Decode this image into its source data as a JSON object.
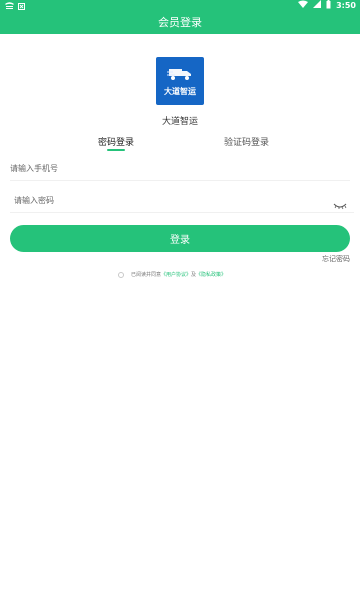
{
  "status_bar": {
    "time": "3:50",
    "left_icons": [
      "wifi-status-icon",
      "notification-icon"
    ],
    "right_icons": [
      "wifi-icon",
      "signal-icon",
      "battery-icon"
    ]
  },
  "header": {
    "title": "会员登录"
  },
  "logo": {
    "text": "大道智运"
  },
  "app": {
    "name": "大道智运"
  },
  "tabs": {
    "password_login": "密码登录",
    "code_login": "验证码登录"
  },
  "form": {
    "phone_placeholder": "请输入手机号",
    "password_placeholder": "请输入密码",
    "login_button": "登录",
    "forgot_password": "忘记密码"
  },
  "agreement": {
    "prefix": "已阅读并同意",
    "user_agreement": "《用户协议》",
    "conjunction": "及",
    "privacy_policy": "《隐私政策》"
  },
  "colors": {
    "primary": "#25c27a",
    "logo_bg": "#1566c5"
  }
}
